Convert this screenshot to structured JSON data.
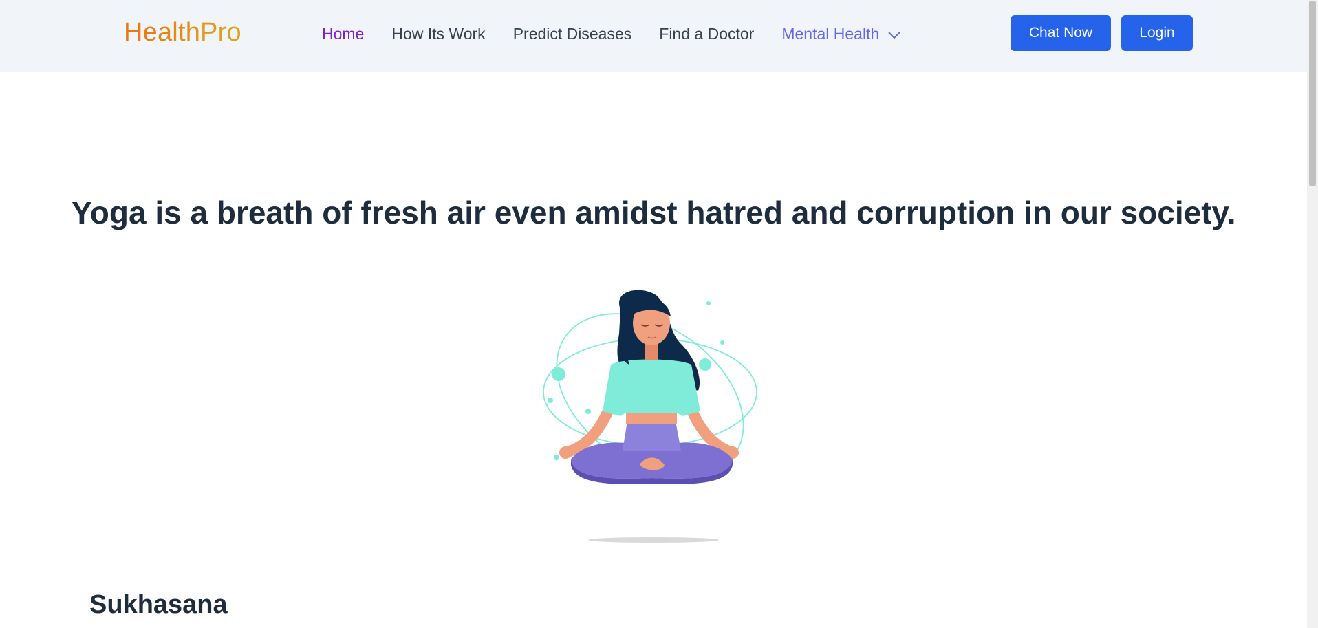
{
  "header": {
    "logo": "HealthPro",
    "nav": [
      {
        "label": "Home"
      },
      {
        "label": "How Its Work"
      },
      {
        "label": "Predict Diseases"
      },
      {
        "label": "Find a Doctor"
      },
      {
        "label": "Mental Health"
      }
    ],
    "chat_label": "Chat Now",
    "login_label": "Login"
  },
  "hero": {
    "title": "Yoga is a breath of fresh air even amidst hatred and corruption in our society."
  },
  "section": {
    "title": "Sukhasana",
    "text": ""
  },
  "colors": {
    "brand_orange": "#ea7512",
    "primary_blue": "#2563eb",
    "nav_active": "#7e22ce",
    "nav_accent": "#6366f1",
    "header_bg": "#f1f5f9",
    "heading": "#1e2d3e"
  },
  "icons": {
    "dropdown": "chevron-down-icon"
  }
}
